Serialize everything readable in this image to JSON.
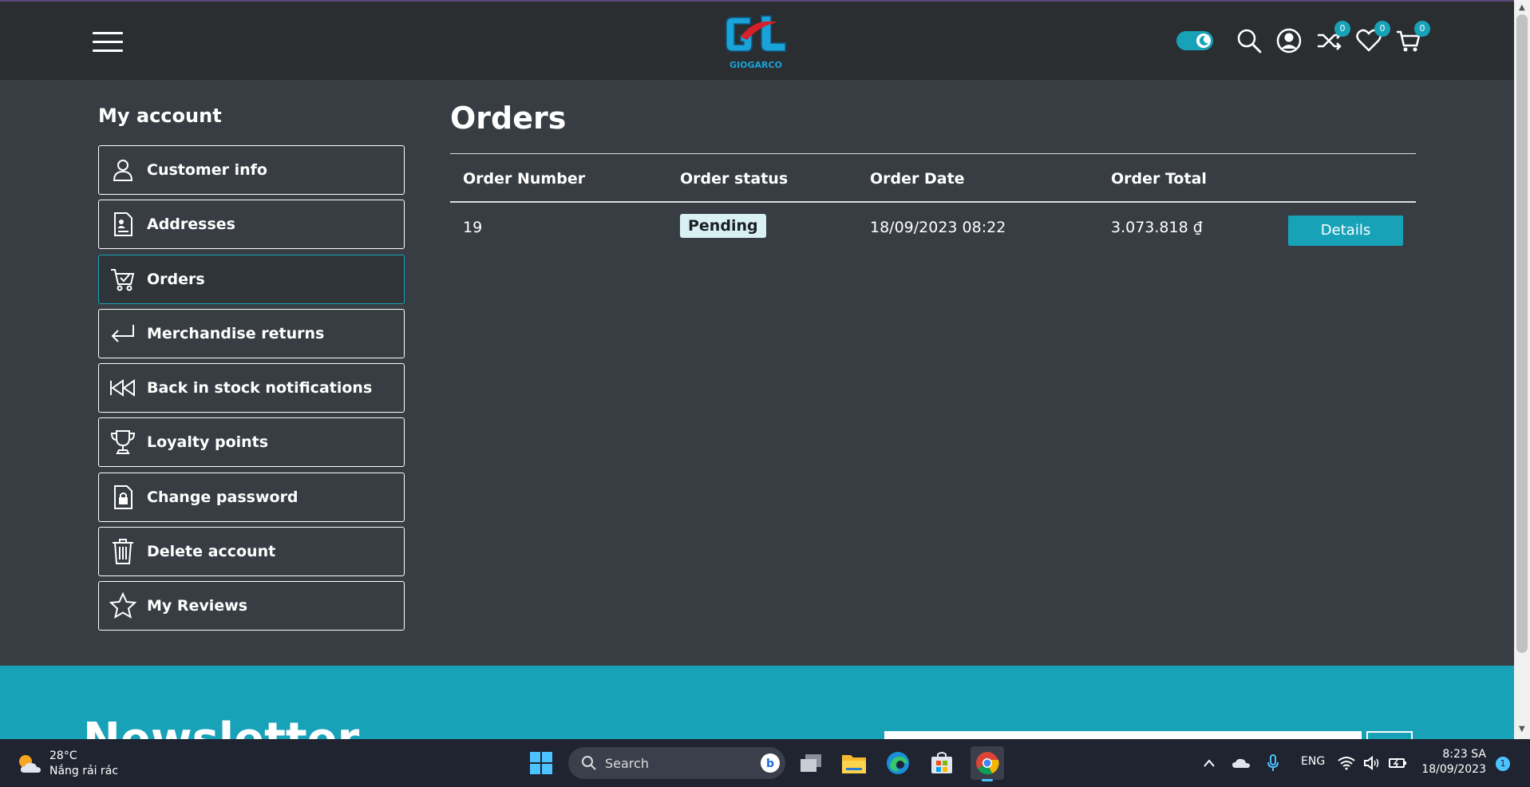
{
  "header": {
    "logo_text": "GIOGARCO",
    "compare_count": "0",
    "wishlist_count": "0",
    "cart_count": "0"
  },
  "sidebar": {
    "title": "My account",
    "items": [
      {
        "label": "Customer info",
        "icon": "user-icon"
      },
      {
        "label": "Addresses",
        "icon": "address-book-icon"
      },
      {
        "label": "Orders",
        "icon": "cart-check-icon"
      },
      {
        "label": "Merchandise returns",
        "icon": "return-arrow-icon"
      },
      {
        "label": "Back in stock notifications",
        "icon": "rewind-icon"
      },
      {
        "label": "Loyalty points",
        "icon": "trophy-icon"
      },
      {
        "label": "Change password",
        "icon": "lock-file-icon"
      },
      {
        "label": "Delete account",
        "icon": "trash-icon"
      },
      {
        "label": "My Reviews",
        "icon": "star-icon"
      }
    ],
    "active_item": "Orders"
  },
  "main": {
    "title": "Orders",
    "table": {
      "headers": [
        "Order Number",
        "Order status",
        "Order Date",
        "Order Total"
      ],
      "rows": [
        {
          "number": "19",
          "status": "Pending",
          "date": "18/09/2023 08:22",
          "total": "3.073.818 ₫",
          "action": "Details"
        }
      ]
    }
  },
  "newsletter": {
    "title": "Newsletter"
  },
  "taskbar": {
    "weather_temp": "28°C",
    "weather_desc": "Nắng rải rác",
    "search_label": "Search",
    "language": "ENG",
    "time": "8:23 SA",
    "date": "18/09/2023",
    "notification_count": "1"
  },
  "colors": {
    "accent": "#17a2b8",
    "background": "#373d43",
    "header": "#2a2e31"
  }
}
